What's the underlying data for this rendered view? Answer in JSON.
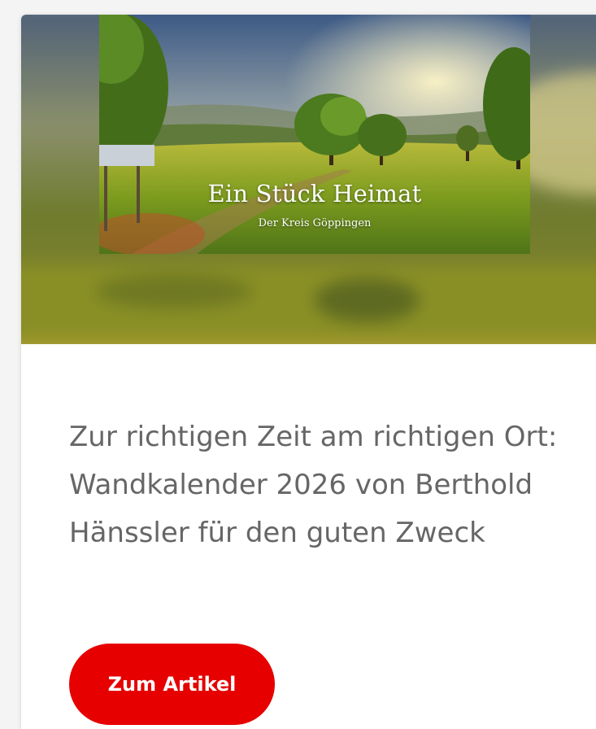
{
  "teaser": {
    "image": {
      "calendar_title": "Ein Stück Heimat",
      "calendar_subtitle": "Der Kreis Göppingen"
    },
    "headline": "Zur richtigen Zeit am richtigen Ort: Wandkalender 2026 von Berthold Hänssler für den guten Zweck",
    "cta_label": "Zum Artikel"
  },
  "colors": {
    "accent": "#e60000",
    "headline_text": "#666666",
    "card_background": "#ffffff"
  }
}
